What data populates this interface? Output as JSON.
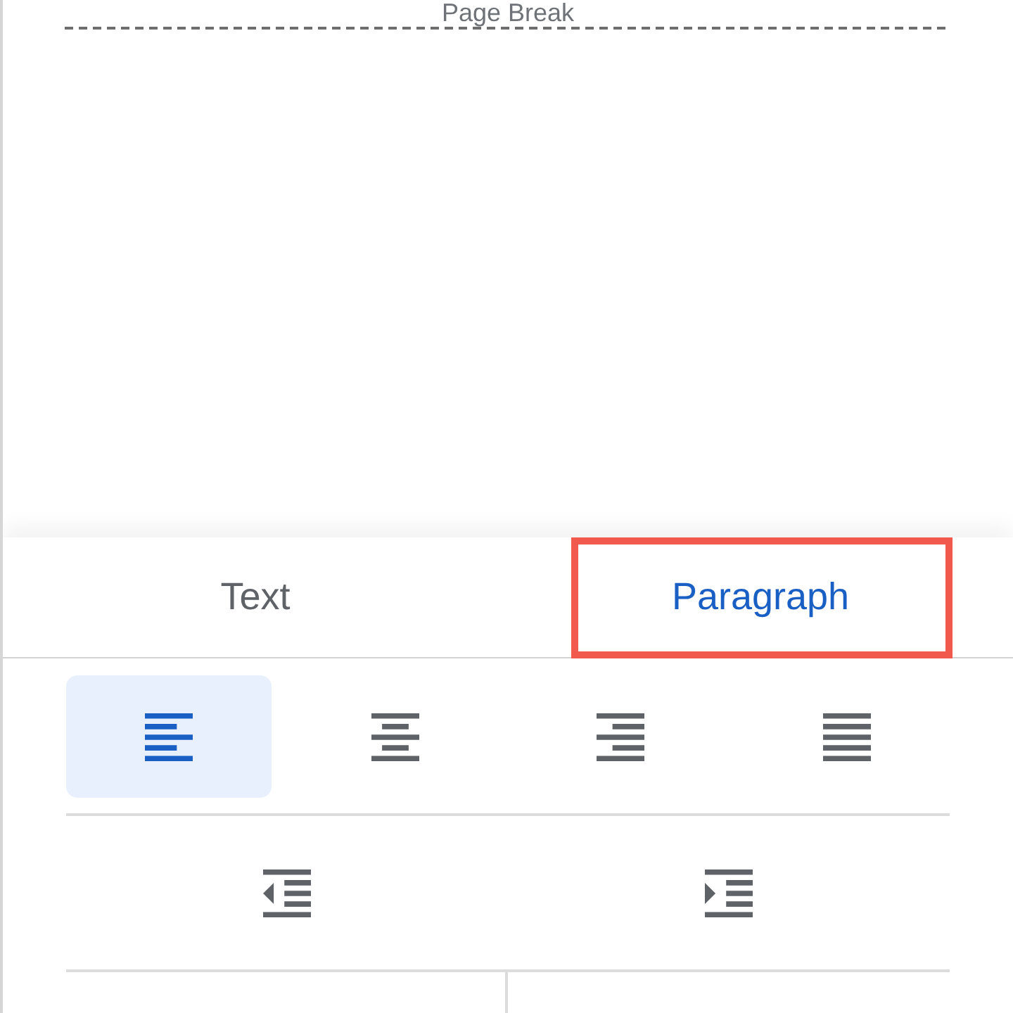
{
  "document": {
    "page_break_label": "Page Break"
  },
  "tabs": [
    {
      "label": "Text",
      "selected": false,
      "highlighted": false
    },
    {
      "label": "Paragraph",
      "selected": true,
      "highlighted": true
    }
  ],
  "alignment_buttons": [
    {
      "kind": "align_left",
      "selected": true
    },
    {
      "kind": "align_center",
      "selected": false
    },
    {
      "kind": "align_right",
      "selected": false
    },
    {
      "kind": "justify",
      "selected": false
    }
  ],
  "indent_buttons": [
    {
      "kind": "decrease_indent"
    },
    {
      "kind": "increase_indent"
    }
  ]
}
